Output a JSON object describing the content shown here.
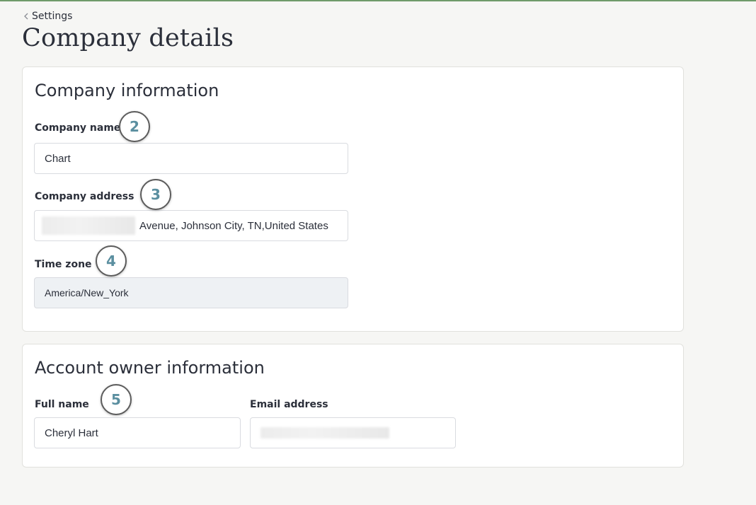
{
  "nav": {
    "back_label": "Settings"
  },
  "page": {
    "title": "Company details"
  },
  "company_card": {
    "title": "Company information",
    "name_label": "Company name",
    "name_value": "Chart",
    "address_label": "Company address",
    "address_visible_value": "Avenue, Johnson City, TN,United States",
    "timezone_label": "Time zone",
    "timezone_value": "America/New_York"
  },
  "owner_card": {
    "title": "Account owner information",
    "full_name_label": "Full name",
    "full_name_value": "Cheryl Hart",
    "email_label": "Email address"
  },
  "badges": {
    "b2": "2",
    "b3": "3",
    "b4": "4",
    "b5": "5"
  },
  "colors": {
    "accent_bar": "#6f9b6a",
    "badge_text": "#5b8fa0",
    "disabled_bg": "#eef1f4"
  }
}
